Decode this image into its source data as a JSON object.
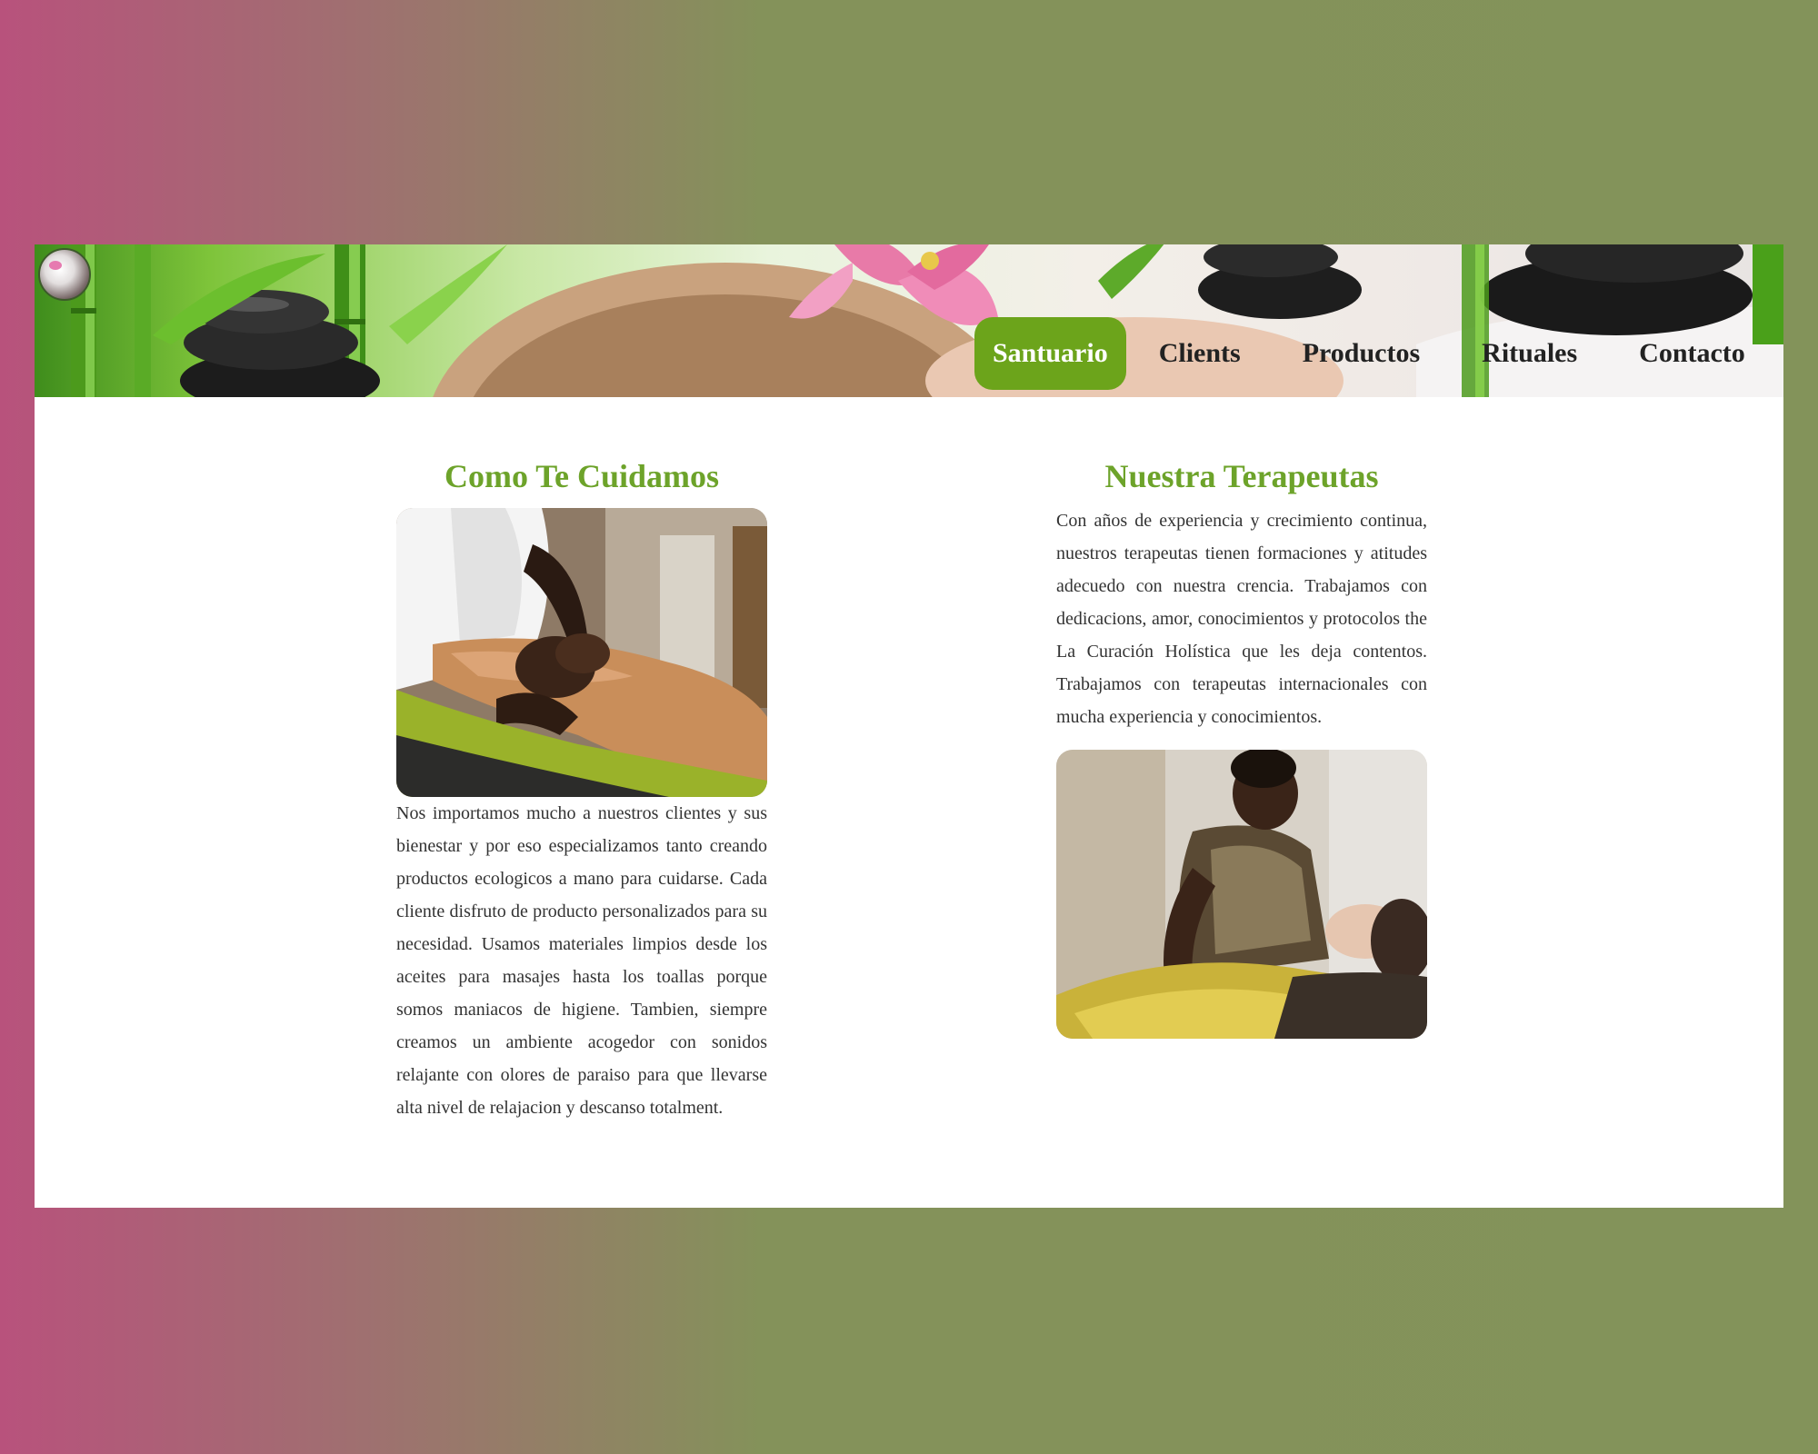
{
  "nav": {
    "items": [
      {
        "label": "Santuario",
        "active": true
      },
      {
        "label": "Clients",
        "active": false
      },
      {
        "label": "Productos",
        "active": false
      },
      {
        "label": "Rituales",
        "active": false
      },
      {
        "label": "Contacto",
        "active": false
      }
    ]
  },
  "left": {
    "title": "Como Te Cuidamos",
    "text": "Nos importamos mucho a nuestros clientes y sus bienestar y por eso especializamos tanto creando productos ecologicos a mano para cuidarse. Cada cliente disfruto de producto personalizados para su necesidad. Usamos materiales limpios desde los aceites para masajes hasta los toallas porque somos maniacos de higiene. Tambien, siempre creamos un ambiente acogedor con sonidos relajante con olores de paraiso para que llevarse alta nivel de relajacion y descanso totalment."
  },
  "right": {
    "title": "Nuestra Terapeutas",
    "text": "Con años de experiencia y crecimiento continua, nuestros terapeutas tienen formaciones y atitudes adecuedo con nuestra crencia. Trabajamos con dedicacions, amor, conocimientos y protocolos the La Curación Holística que les deja contentos. Trabajamos con terapeutas internacionales con mucha experiencia y conocimientos."
  },
  "colors": {
    "accent": "#6ca41b",
    "heading": "#6da32a",
    "text": "#333333"
  }
}
